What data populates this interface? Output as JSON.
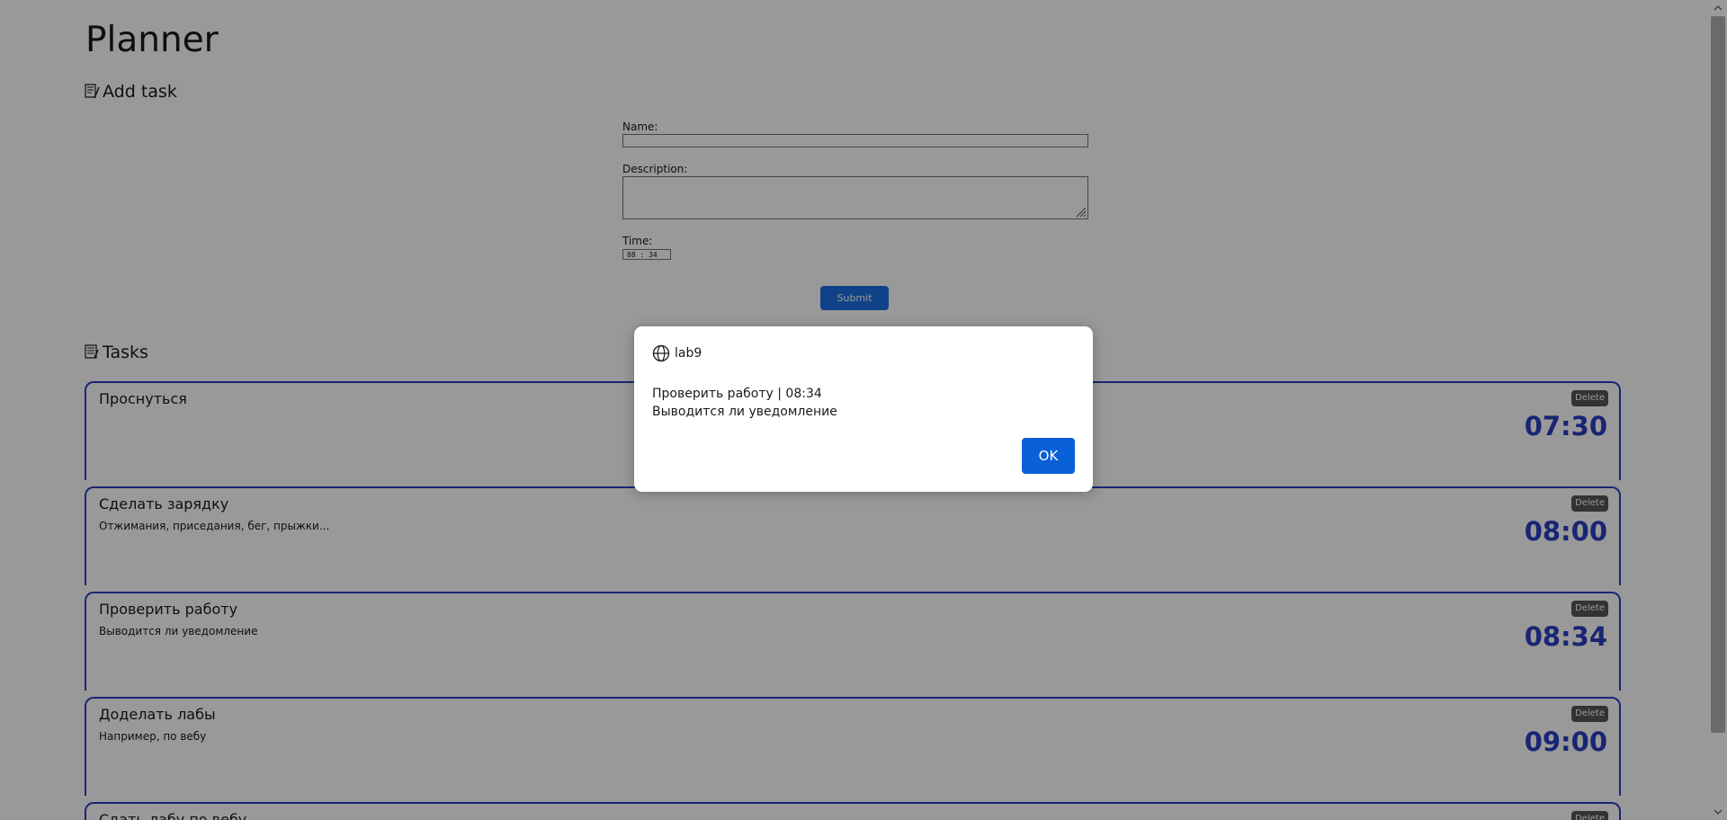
{
  "page": {
    "title": "Planner"
  },
  "add_task": {
    "heading": "Add task",
    "icon": "edit-document-icon",
    "name_label": "Name:",
    "name_value": "",
    "description_label": "Description:",
    "description_value": "",
    "time_label": "Time:",
    "time_value": "08 : 34",
    "submit_label": "Submit",
    "submit_color": "#1a6fe0"
  },
  "tasks": {
    "heading": "Tasks",
    "icon": "list-document-icon",
    "accent_color": "#2b3fc2",
    "delete_label": "Delete",
    "items": [
      {
        "name": "Проснуться",
        "description": "",
        "time": "07:30"
      },
      {
        "name": "Сделать зарядку",
        "description": "Отжимания, приседания, бег, прыжки...",
        "time": "08:00"
      },
      {
        "name": "Проверить работу",
        "description": "Выводится ли уведомление",
        "time": "08:34"
      },
      {
        "name": "Доделать лабы",
        "description": "Например, по вебу",
        "time": "09:00"
      },
      {
        "name": "Сдать лабу по вебу",
        "description": "",
        "time": ""
      }
    ]
  },
  "alert": {
    "origin": "lab9",
    "origin_icon": "globe-icon",
    "line1": "Проверить работу | 08:34",
    "line2": "Выводится ли уведомление",
    "ok_label": "OK",
    "ok_color": "#0a60d6"
  }
}
